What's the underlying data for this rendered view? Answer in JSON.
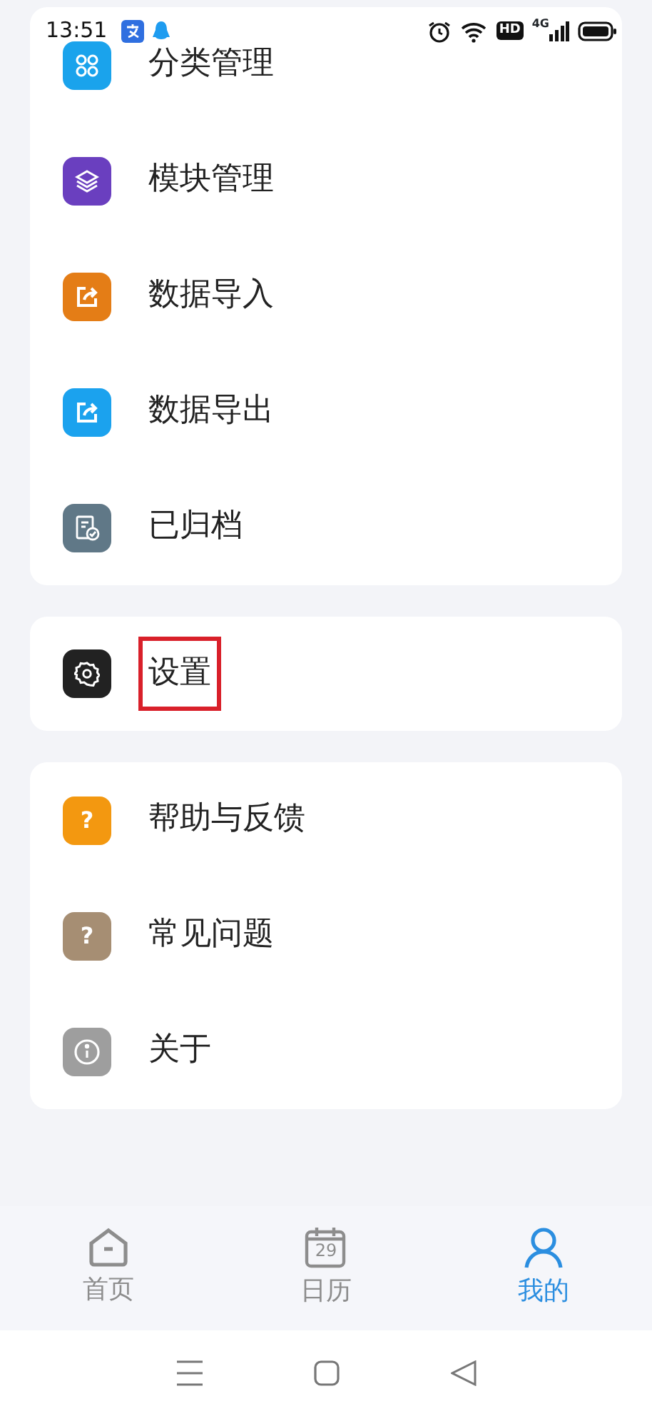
{
  "status_bar": {
    "time": "13:51",
    "hd_label": "HD",
    "network_label": "4G"
  },
  "groups": [
    {
      "items": [
        {
          "label": "分类管理",
          "kind": "grid",
          "color": "#1aa3ec",
          "highlighted": false
        },
        {
          "label": "模块管理",
          "kind": "layers",
          "color": "#6a3fbf",
          "highlighted": false
        },
        {
          "label": "数据导入",
          "kind": "share",
          "color": "#e47d16",
          "highlighted": false
        },
        {
          "label": "数据导出",
          "kind": "share",
          "color": "#1ba2ee",
          "highlighted": false
        },
        {
          "label": "已归档",
          "kind": "archive",
          "color": "#607887",
          "highlighted": false
        }
      ]
    },
    {
      "items": [
        {
          "label": "设置",
          "kind": "gear",
          "color": "#222222",
          "highlighted": true
        }
      ]
    },
    {
      "items": [
        {
          "label": "帮助与反馈",
          "kind": "glyph",
          "glyph": "?",
          "color": "#f39810",
          "highlighted": false
        },
        {
          "label": "常见问题",
          "kind": "glyph",
          "glyph": "?",
          "color": "#a68e73",
          "highlighted": false
        },
        {
          "label": "关于",
          "kind": "info",
          "color": "#9e9e9e",
          "highlighted": false
        }
      ]
    }
  ],
  "tabs": [
    {
      "label": "首页",
      "kind": "home",
      "selected": false
    },
    {
      "label": "日历",
      "kind": "calendar",
      "calendar_day": "29",
      "selected": false
    },
    {
      "label": "我的",
      "kind": "person",
      "selected": true
    }
  ]
}
